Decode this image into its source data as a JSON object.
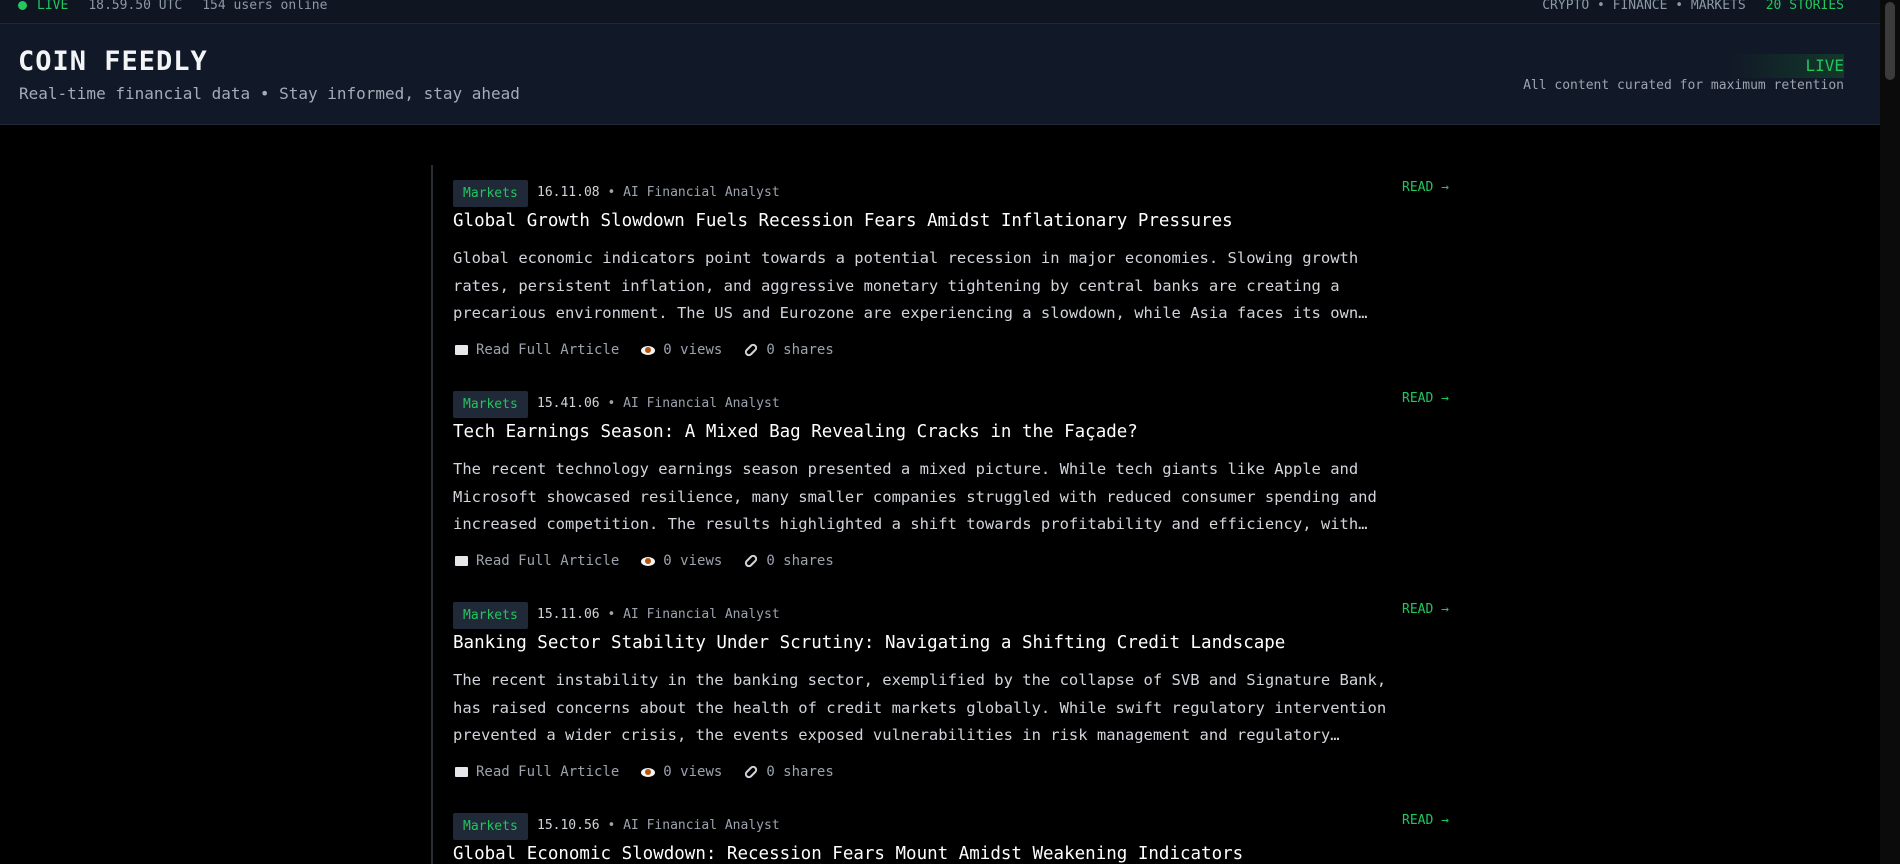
{
  "topbar": {
    "live_label": "LIVE",
    "time": "18.59.50 UTC",
    "users_online": "154 users online",
    "categories": "CRYPTO • FINANCE • MARKETS",
    "stories": "20 STORIES"
  },
  "header": {
    "title": "COIN FEEDLY",
    "tagline": "Real-time financial data • Stay informed, stay ahead",
    "live_badge": "LIVE",
    "retention_note": "All content curated for maximum retention"
  },
  "articles": [
    {
      "category": "Markets",
      "time": "16.11.08",
      "author": "• AI Financial Analyst",
      "read_label": "READ →",
      "title": "Global Growth Slowdown Fuels Recession Fears Amidst Inflationary Pressures",
      "summary": "Global economic indicators point towards a potential recession in major economies. Slowing growth rates, persistent inflation, and aggressive monetary tightening by central banks are creating a precarious environment. The US and Eurozone are experiencing a slowdown, while Asia faces its own…",
      "read_full": "Read Full Article",
      "views": "0 views",
      "shares": "0 shares"
    },
    {
      "category": "Markets",
      "time": "15.41.06",
      "author": "• AI Financial Analyst",
      "read_label": "READ →",
      "title": "Tech Earnings Season: A Mixed Bag Revealing Cracks in the Façade?",
      "summary": "The recent technology earnings season presented a mixed picture. While tech giants like Apple and Microsoft showcased resilience, many smaller companies struggled with reduced consumer spending and increased competition. The results highlighted a shift towards profitability and efficiency, with…",
      "read_full": "Read Full Article",
      "views": "0 views",
      "shares": "0 shares"
    },
    {
      "category": "Markets",
      "time": "15.11.06",
      "author": "• AI Financial Analyst",
      "read_label": "READ →",
      "title": "Banking Sector Stability Under Scrutiny: Navigating a Shifting Credit Landscape",
      "summary": "The recent instability in the banking sector, exemplified by the collapse of SVB and Signature Bank, has raised concerns about the health of credit markets globally. While swift regulatory intervention prevented a wider crisis, the events exposed vulnerabilities in risk management and regulatory…",
      "read_full": "Read Full Article",
      "views": "0 views",
      "shares": "0 shares"
    },
    {
      "category": "Markets",
      "time": "15.10.56",
      "author": "• AI Financial Analyst",
      "read_label": "READ →",
      "title": "Global Economic Slowdown: Recession Fears Mount Amidst Weakening Indicators"
    }
  ],
  "colors": {
    "accent_green": "#22c55e",
    "background": "#000000",
    "header_bg": "#111827"
  }
}
